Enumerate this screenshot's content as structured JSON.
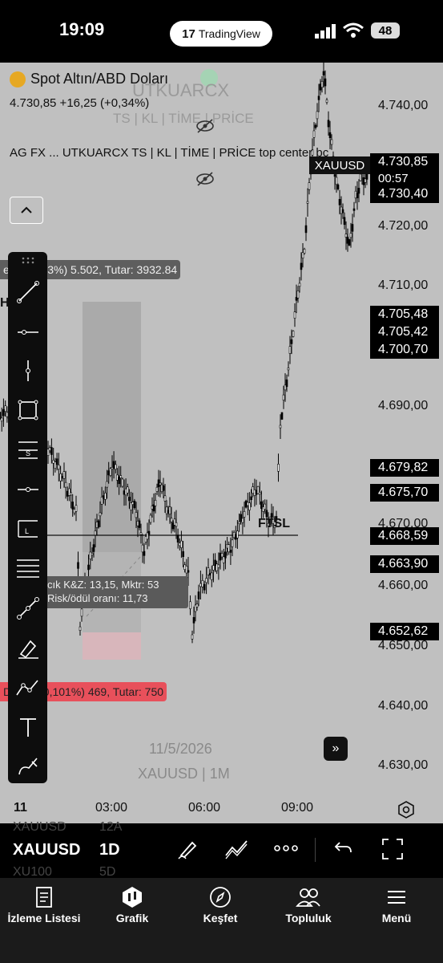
{
  "status_bar": {
    "time": "19:09",
    "app_pill": "TradingView",
    "battery": "48"
  },
  "chart_header": {
    "symbol_title": "Spot Altın/ABD Doları",
    "price_line": "4.730,85 +16,25 (+0,34%)",
    "watermark_title": "UTKUARCX",
    "watermark_sub": "TS | KL | TİME | PRİCE",
    "indicator_line": "AG FX ... UTKUARCX TS | KL | TİME | PRİCE top center bc"
  },
  "positions": {
    "target_label": "e 2 (1,183%) 5.502, Tutar: 3932.84",
    "h_label": "H",
    "rr_line1": "cık K&Z: 13,15, Mktr: 53",
    "rr_line2": "Risk/ödül oranı: 11,73",
    "stop_label": "D 4,69 (0,101%) 469, Tutar: 750",
    "ftsl_label": "FTSL"
  },
  "watermark": {
    "date": "11/5/2026",
    "symbol_interval": "XAUUSD | 1M"
  },
  "price_axis": {
    "ticks": [
      "4.740,00",
      "4.720,00",
      "4.710,00",
      "4.690,00",
      "4.670,00",
      "4.660,00",
      "4.650,00",
      "4.640,00",
      "4.630,00"
    ],
    "badges": [
      "4.730,85",
      "00:57",
      "4.730,40",
      "4.705,48",
      "4.705,42",
      "4.700,70",
      "4.679,82",
      "4.675,70",
      "4.668,59",
      "4.663,90",
      "4.652,62"
    ],
    "symbol_tag": "XAUUSD"
  },
  "time_axis": {
    "labels": [
      "11",
      "03:00",
      "06:00",
      "09:00"
    ]
  },
  "bottom_toolbar": {
    "symbol": "XAUUSD",
    "interval": "1D",
    "ghost_symbols": [
      "XAUUSD",
      "XU100"
    ],
    "ghost_intervals": [
      "12A",
      "5D"
    ]
  },
  "nav": {
    "items": [
      "İzleme Listesi",
      "Grafik",
      "Keşfet",
      "Topluluk",
      "Menü"
    ]
  },
  "colors": {
    "chart_bg": "#c0c0c0",
    "stop_red": "#e8505b",
    "candle": "#000000"
  }
}
